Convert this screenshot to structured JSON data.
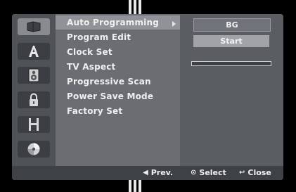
{
  "colors": {
    "panel": "#8f9093",
    "side_column": "#4f5358",
    "menu_column": "#6b6d72",
    "menu_highlight": "#909297",
    "options_column": "#5a5d62",
    "footer": "#3e4247",
    "text": "#eef0f0"
  },
  "sidebar": {
    "items": [
      {
        "icon": "disc-setup-icon",
        "active": true
      },
      {
        "icon": "language-a-icon",
        "active": false
      },
      {
        "icon": "speaker-audio-icon",
        "active": false
      },
      {
        "icon": "padlock-icon",
        "active": false
      },
      {
        "icon": "film-recording-icon",
        "active": false
      },
      {
        "icon": "disc-icon",
        "active": false
      }
    ]
  },
  "menu": {
    "selected_index": 0,
    "items": [
      "Auto Programming",
      "Program Edit",
      "Clock Set",
      "TV Aspect",
      "Progressive Scan",
      "Power Save Mode",
      "Factory Set"
    ]
  },
  "options": {
    "system": "BG",
    "start_label": "Start",
    "progress": 0
  },
  "footer": {
    "prev_label": "Prev.",
    "select_label": "Select",
    "close_label": "Close"
  }
}
